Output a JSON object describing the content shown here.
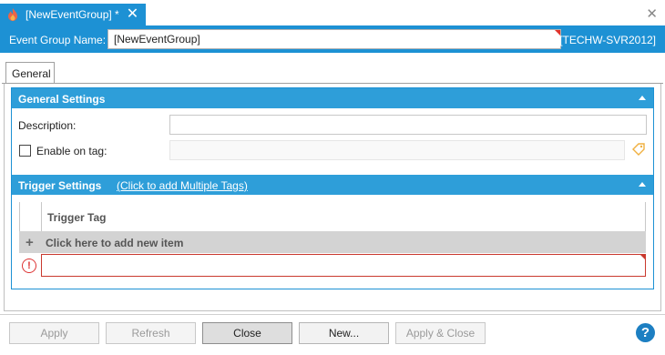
{
  "document_tab": {
    "title": "[NewEventGroup] *",
    "close_glyph": "✕",
    "icon": "flame-icon"
  },
  "window": {
    "close_glyph": "✕"
  },
  "header": {
    "name_label": "Event Group Name:",
    "name_value": "[NewEventGroup]",
    "server": "[TECHW-SVR2012]"
  },
  "tabs": [
    {
      "label": "General",
      "selected": true
    }
  ],
  "general_settings": {
    "title": "General Settings",
    "description_label": "Description:",
    "description_value": "",
    "enable_on_tag_label": "Enable on tag:",
    "enable_on_tag_checked": false,
    "tag_value": "",
    "tag_picker_icon": "tag-icon"
  },
  "trigger_settings": {
    "title": "Trigger Settings",
    "multi_link": "(Click to add Multiple Tags)",
    "column_header": "Trigger Tag",
    "add_row_plus": "+",
    "add_row_text": "Click here to add new item",
    "error_glyph": "!",
    "new_row_value": ""
  },
  "buttons": {
    "apply": "Apply",
    "refresh": "Refresh",
    "close": "Close",
    "new": "New...",
    "apply_close": "Apply & Close",
    "help": "?"
  },
  "colors": {
    "accent": "#1d91d4",
    "section_bar": "#2e9ed9",
    "error": "#c9392e",
    "help": "#1d7fc2"
  }
}
